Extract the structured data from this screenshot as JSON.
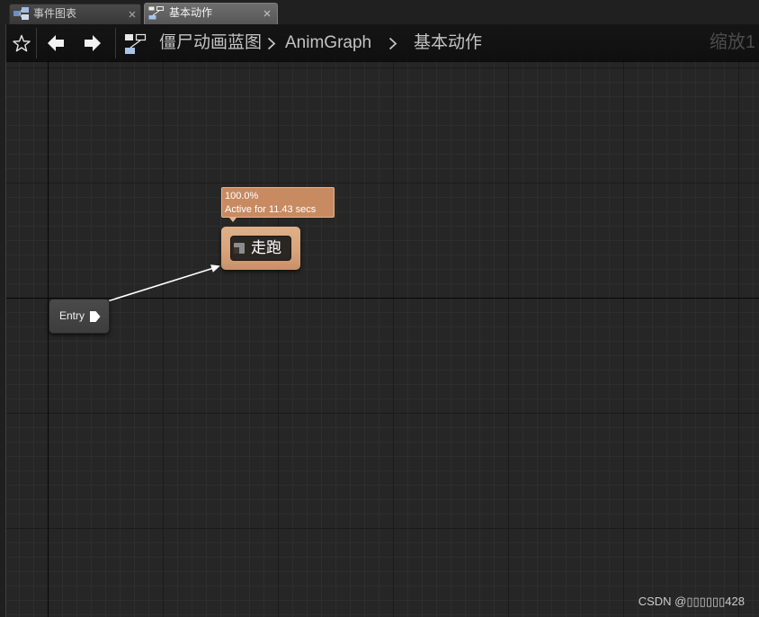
{
  "tabs": [
    {
      "label": "事件图表",
      "icon": "event-graph-icon",
      "active": false
    },
    {
      "label": "基本动作",
      "icon": "state-machine-icon",
      "active": true
    }
  ],
  "toolbar": {
    "icons": [
      "star-icon",
      "arrow-left-icon",
      "arrow-right-icon",
      "state-machine-icon"
    ],
    "breadcrumbs": [
      "僵尸动画蓝图",
      "AnimGraph",
      "基本动作"
    ],
    "breadcrumb_separator_icon": "chevron-right-icon",
    "zoom_label": "缩放1"
  },
  "graph": {
    "entry_node": {
      "label": "Entry",
      "icon": "entry-arrow-icon"
    },
    "states": [
      {
        "label": "走跑",
        "icon": "state-icon",
        "active": true,
        "debug_tooltip": {
          "weight": "100.0%",
          "active_time": "Active for 11.43 secs"
        }
      }
    ]
  },
  "watermark": "CSDN @▯▯▯▯▯▯428",
  "colors": {
    "graph_background": "#262626",
    "grid_minor": "#2e2e2e",
    "grid_major": "#1b1b1b",
    "grid_origin": "#070707",
    "active_state": "#d8a47c",
    "debug_tooltip": "#c88a61",
    "entry_node": "#3d3d3d",
    "wire": "#ffffff"
  }
}
